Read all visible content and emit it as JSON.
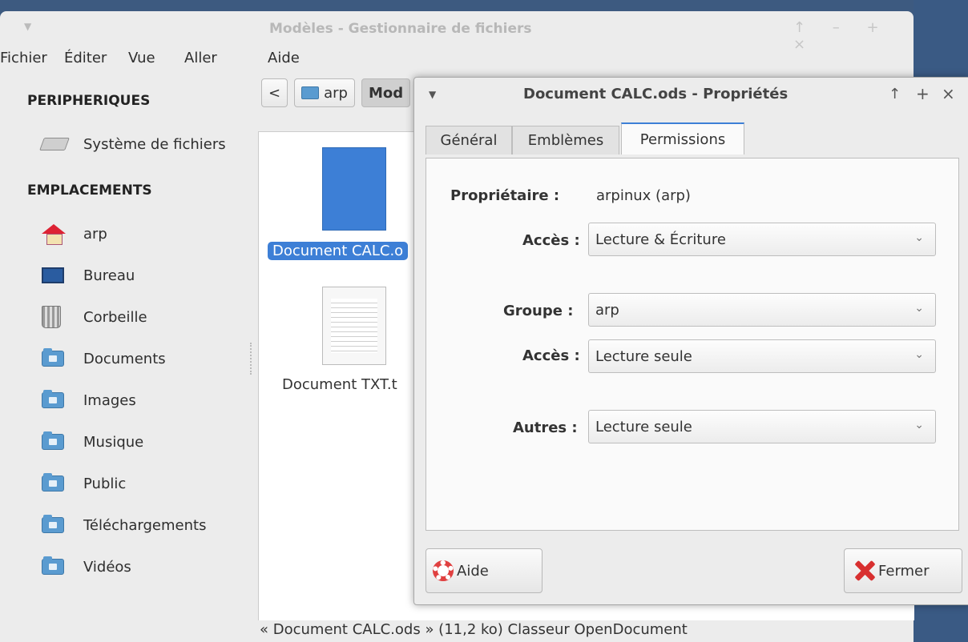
{
  "file_manager": {
    "title": "Modèles - Gestionnaire de fichiers",
    "controls": "↑ – + ×",
    "menu": [
      "Fichier",
      "Éditer",
      "Vue",
      "Aller",
      "Aide"
    ],
    "sidebar": {
      "devices_header": "PERIPHERIQUES",
      "devices": [
        {
          "label": "Système de fichiers",
          "icon": "drive-icon"
        }
      ],
      "places_header": "EMPLACEMENTS",
      "places": [
        {
          "label": "arp",
          "icon": "home-icon"
        },
        {
          "label": "Bureau",
          "icon": "desktop-icon"
        },
        {
          "label": "Corbeille",
          "icon": "trash-icon"
        },
        {
          "label": "Documents",
          "icon": "folder-documents-icon"
        },
        {
          "label": "Images",
          "icon": "folder-pictures-icon"
        },
        {
          "label": "Musique",
          "icon": "folder-music-icon"
        },
        {
          "label": "Public",
          "icon": "folder-public-icon"
        },
        {
          "label": "Téléchargements",
          "icon": "folder-download-icon"
        },
        {
          "label": "Vidéos",
          "icon": "folder-videos-icon"
        }
      ]
    },
    "pathbar": {
      "back": "<",
      "home": "arp",
      "current": "Mod"
    },
    "files": [
      {
        "label": "Document CALC.o",
        "selected": true
      },
      {
        "label": "Document TXT.t",
        "selected": false
      }
    ],
    "status": "« Document CALC.ods » (11,2 ko) Classeur OpenDocument"
  },
  "dialog": {
    "title": "Document CALC.ods - Propriétés",
    "controls": {
      "up": "↑",
      "plus": "+",
      "close": "×"
    },
    "tabs": [
      "Général",
      "Emblèmes",
      "Permissions"
    ],
    "active_tab": "Permissions",
    "owner_label": "Propriétaire :",
    "owner_value": "arpinux (arp)",
    "owner_access_label": "Accès :",
    "owner_access_value": "Lecture & Écriture",
    "group_label": "Groupe :",
    "group_value": "arp",
    "group_access_label": "Accès :",
    "group_access_value": "Lecture seule",
    "others_label": "Autres :",
    "others_value": "Lecture seule",
    "help_button": "Aide",
    "close_button": "Fermer"
  },
  "colors": {
    "accent": "#3d7fd6",
    "desktop": "#3d5a80"
  }
}
